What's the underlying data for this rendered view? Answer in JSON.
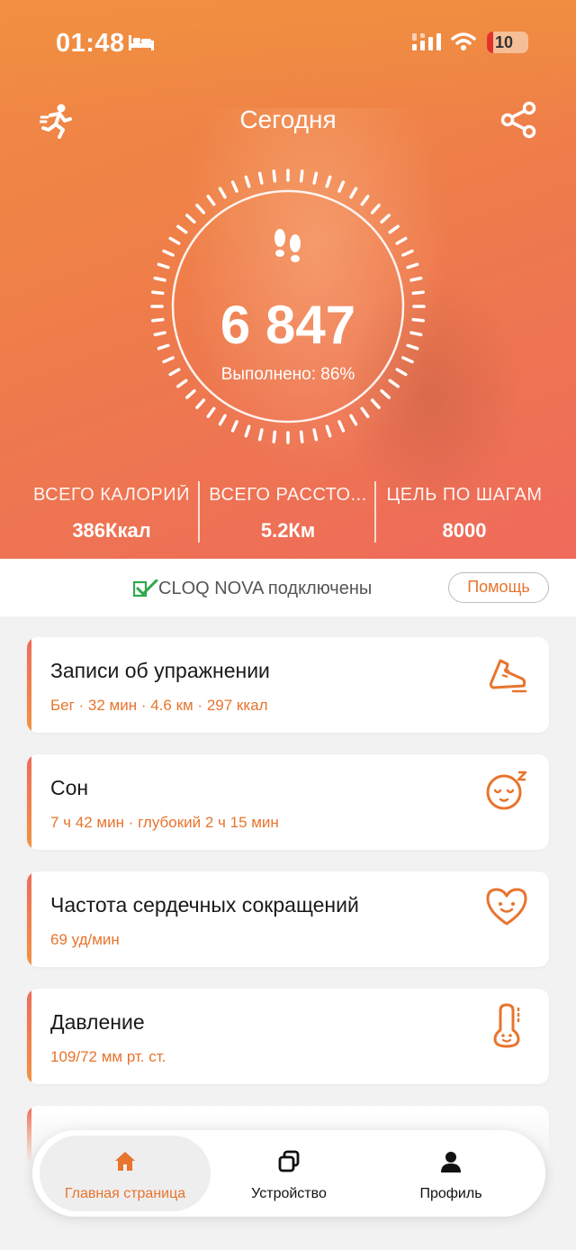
{
  "status_bar": {
    "time": "01:48",
    "battery": "10"
  },
  "header": {
    "title": "Сегодня"
  },
  "steps": {
    "value": "6 847",
    "progress_text": "Выполнено: 86%",
    "progress": 0.86
  },
  "stats": [
    {
      "label": "ВСЕГО КАЛОРИЙ",
      "value": "386Ккал"
    },
    {
      "label": "ВСЕГО РАССТО...",
      "value": "5.2Км"
    },
    {
      "label": "ЦЕЛЬ ПО ШАГАМ",
      "value": "8000"
    }
  ],
  "connection": {
    "text": "CLOQ NOVA подключены",
    "help_label": "Помощь"
  },
  "cards": [
    {
      "title": "Записи об упражнении",
      "subtitle": "Бег · 32 мин · 4.6 км · 297 ккал",
      "icon": "sneaker-icon"
    },
    {
      "title": "Сон",
      "subtitle": "7 ч 42 мин · глубокий 2 ч 15 мин",
      "icon": "sleep-face-icon"
    },
    {
      "title": "Частота сердечных сокращений",
      "subtitle": "69 уд/мин",
      "icon": "heart-face-icon"
    },
    {
      "title": "Давление",
      "subtitle": "109/72 мм рт. ст.",
      "icon": "thermometer-icon"
    }
  ],
  "nav": [
    {
      "label": "Главная страница",
      "icon": "home-icon",
      "active": true
    },
    {
      "label": "Устройство",
      "icon": "device-icon",
      "active": false
    },
    {
      "label": "Профиль",
      "icon": "profile-icon",
      "active": false
    }
  ],
  "colors": {
    "accent": "#e8742e",
    "hero_top": "#f08a44",
    "hero_bottom": "#ef6a5b"
  }
}
